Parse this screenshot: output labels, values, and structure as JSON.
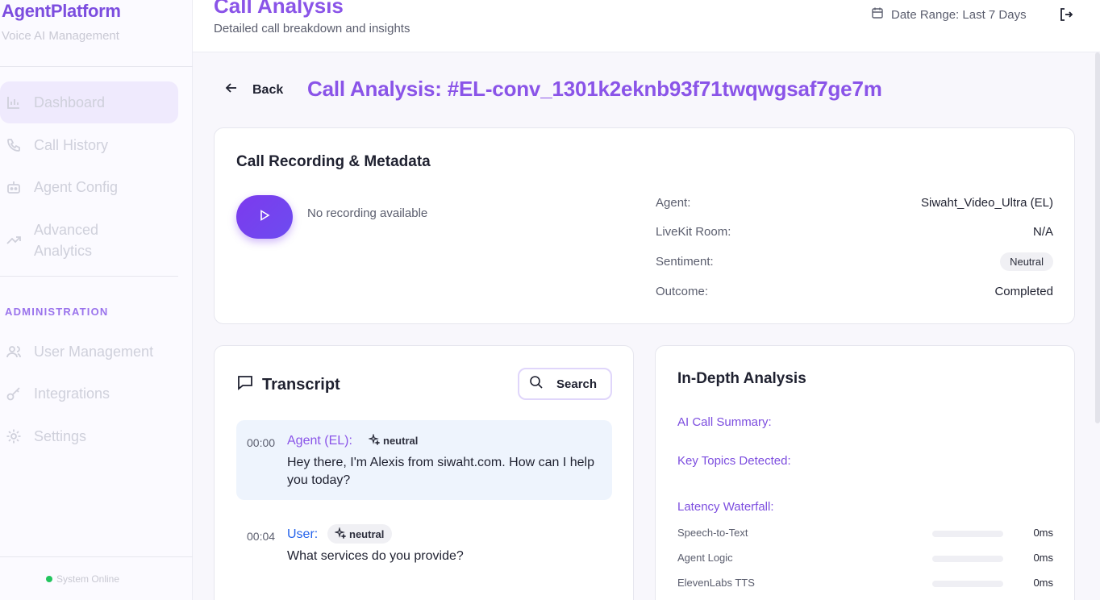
{
  "sidebar": {
    "brand": "AgentPlatform",
    "brand_sub": "Voice AI Management",
    "nav": [
      {
        "label": "Dashboard",
        "icon": "bar-chart-icon"
      },
      {
        "label": "Call History",
        "icon": "phone-icon"
      },
      {
        "label": "Agent Config",
        "icon": "bot-icon"
      },
      {
        "label": "Advanced Analytics",
        "icon": "trending-up-icon"
      }
    ],
    "admin_label": "ADMINISTRATION",
    "admin": [
      {
        "label": "User Management",
        "icon": "users-icon"
      },
      {
        "label": "Integrations",
        "icon": "key-icon"
      },
      {
        "label": "Settings",
        "icon": "gear-icon"
      }
    ],
    "status": "System Online"
  },
  "header": {
    "title": "Call Analysis",
    "subtitle": "Detailed call breakdown and insights",
    "date_range": "Date Range: Last 7 Days"
  },
  "main": {
    "back_label": "Back",
    "call_title": "Call Analysis: #EL-conv_1301k2eknb93f71twqwgsaf7ge7m",
    "recording": {
      "title": "Call Recording & Metadata",
      "no_recording": "No recording available",
      "meta": [
        {
          "key": "Agent:",
          "value": "Siwaht_Video_Ultra (EL)"
        },
        {
          "key": "LiveKit Room:",
          "value": "N/A"
        },
        {
          "key": "Sentiment:",
          "value": "Neutral"
        },
        {
          "key": "Outcome:",
          "value": "Completed"
        }
      ]
    },
    "transcript": {
      "title": "Transcript",
      "search_label": "Search",
      "messages": [
        {
          "time": "00:00",
          "speaker": "Agent (EL):",
          "sentiment": "neutral",
          "text": "Hey there, I'm Alexis from siwaht.com. How can I help you today?"
        },
        {
          "time": "00:04",
          "speaker": "User:",
          "sentiment": "neutral",
          "text": "What services do you provide?"
        }
      ]
    },
    "analysis": {
      "title": "In-Depth Analysis",
      "summary_label": "AI Call Summary:",
      "topics_label": "Key Topics Detected:",
      "latency_label": "Latency Waterfall:",
      "latency": [
        {
          "name": "Speech-to-Text",
          "value": "0ms",
          "fraction": 0
        },
        {
          "name": "Agent Logic",
          "value": "0ms",
          "fraction": 0
        },
        {
          "name": "ElevenLabs TTS",
          "value": "0ms",
          "fraction": 0
        }
      ]
    }
  },
  "colors": {
    "accent": "#8a54e8",
    "user_speaker": "#2563eb",
    "status_online": "#22c55e"
  }
}
